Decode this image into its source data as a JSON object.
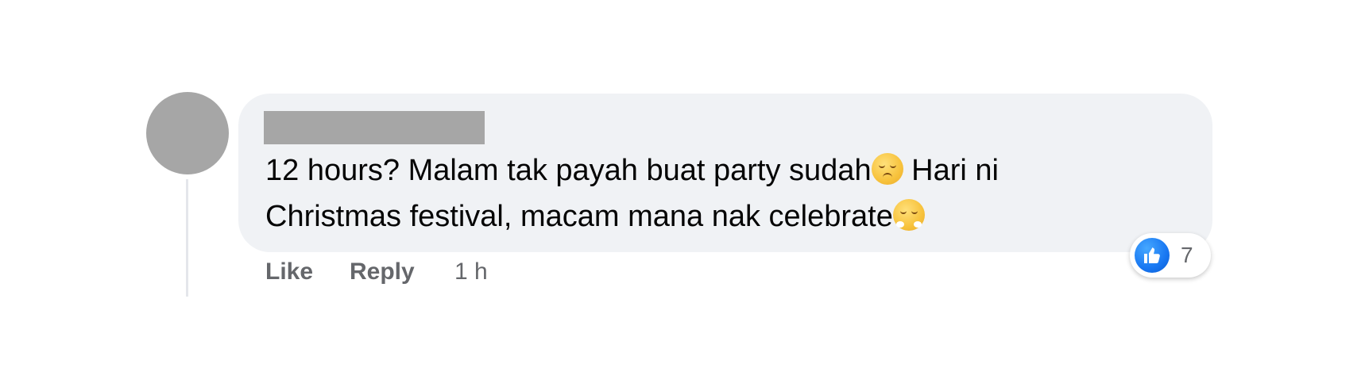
{
  "comment": {
    "author_name": "",
    "text_line1": "12 hours? Malam tak payah buat party sudah",
    "emoji1": "pensive-face-emoji",
    "text_line1_cont": " Hari ni",
    "text_line2": "Christmas festival, macam mana nak celebrate",
    "emoji2": "face-with-steam-emoji"
  },
  "actions": {
    "like_label": "Like",
    "reply_label": "Reply",
    "time": "1 h"
  },
  "reaction": {
    "icon": "thumbs-up-icon",
    "count": "7",
    "color": "#1877f2"
  },
  "colors": {
    "bubble": "#f0f2f5",
    "placeholder": "#a6a6a6",
    "secondary_text": "#65676b"
  }
}
